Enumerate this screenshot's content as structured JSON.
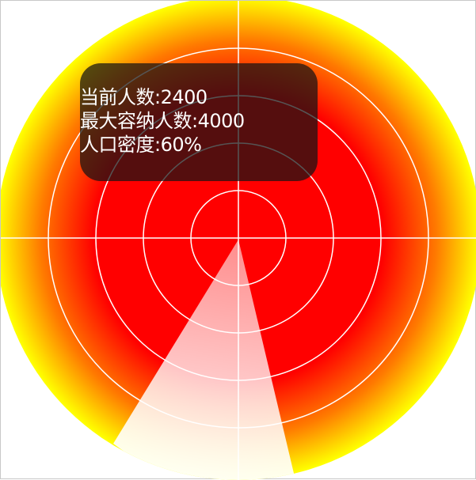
{
  "radar": {
    "colors": {
      "center": "#ff0000",
      "mid": "#ff8800",
      "edge": "#ffff00",
      "grid": "#ffffff",
      "sweep_start": "#ffffff",
      "sweep_end": "#ffeeee"
    },
    "ring_count": 5
  },
  "info": {
    "current_count_label": "当前人数:2400",
    "max_capacity_label": "最大容纳人数:4000",
    "density_label": "人口密度:60%"
  }
}
